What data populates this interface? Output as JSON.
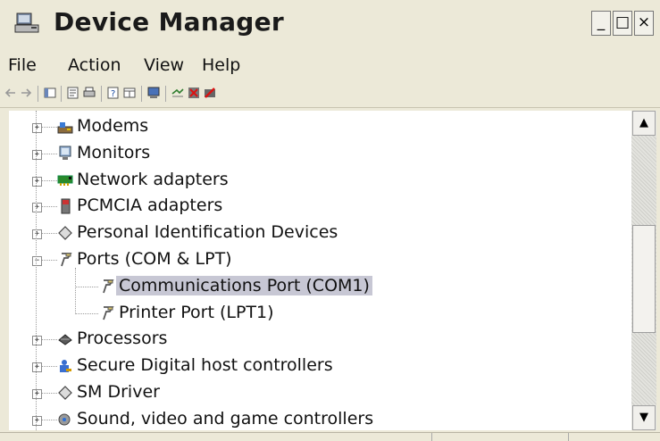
{
  "window": {
    "title": "Device Manager",
    "minimize_glyph": "_",
    "maximize_glyph": "□",
    "close_glyph": "×"
  },
  "menu": [
    "File",
    "Action",
    "View",
    "Help"
  ],
  "toolbar": {
    "icons": [
      "back-arrow-icon",
      "forward-arrow-icon",
      "console-tree-icon",
      "properties-icon",
      "print-icon",
      "help-icon",
      "view-icon",
      "scan-hardware-icon",
      "update-driver-icon",
      "uninstall-icon",
      "disable-icon"
    ]
  },
  "tree": {
    "items": [
      {
        "label": "Modems",
        "icon": "modem-icon",
        "level": 0,
        "expander": "+"
      },
      {
        "label": "Monitors",
        "icon": "monitor-icon",
        "level": 0,
        "expander": "+"
      },
      {
        "label": "Network adapters",
        "icon": "network-adapter-icon",
        "level": 0,
        "expander": "+"
      },
      {
        "label": "PCMCIA adapters",
        "icon": "pcmcia-icon",
        "level": 0,
        "expander": "+"
      },
      {
        "label": "Personal Identification Devices",
        "icon": "diamond-icon",
        "level": 0,
        "expander": "+"
      },
      {
        "label": "Ports (COM & LPT)",
        "icon": "port-icon",
        "level": 0,
        "expander": "−"
      },
      {
        "label": "Communications Port (COM1)",
        "icon": "port-icon",
        "level": 1,
        "expander": "",
        "selected": true
      },
      {
        "label": "Printer Port (LPT1)",
        "icon": "port-icon",
        "level": 1,
        "expander": ""
      },
      {
        "label": "Processors",
        "icon": "processor-icon",
        "level": 0,
        "expander": "+"
      },
      {
        "label": "Secure Digital host controllers",
        "icon": "sd-controller-icon",
        "level": 0,
        "expander": "+"
      },
      {
        "label": "SM Driver",
        "icon": "diamond-icon",
        "level": 0,
        "expander": "+"
      },
      {
        "label": "Sound, video and game controllers",
        "icon": "sound-icon",
        "level": 0,
        "expander": "+"
      }
    ]
  },
  "scrollbar": {
    "up_glyph": "▲",
    "down_glyph": "▼",
    "position_fraction": 0.55
  },
  "colors": {
    "selection": "#c7c7d4",
    "chrome": "#ece9d8"
  }
}
